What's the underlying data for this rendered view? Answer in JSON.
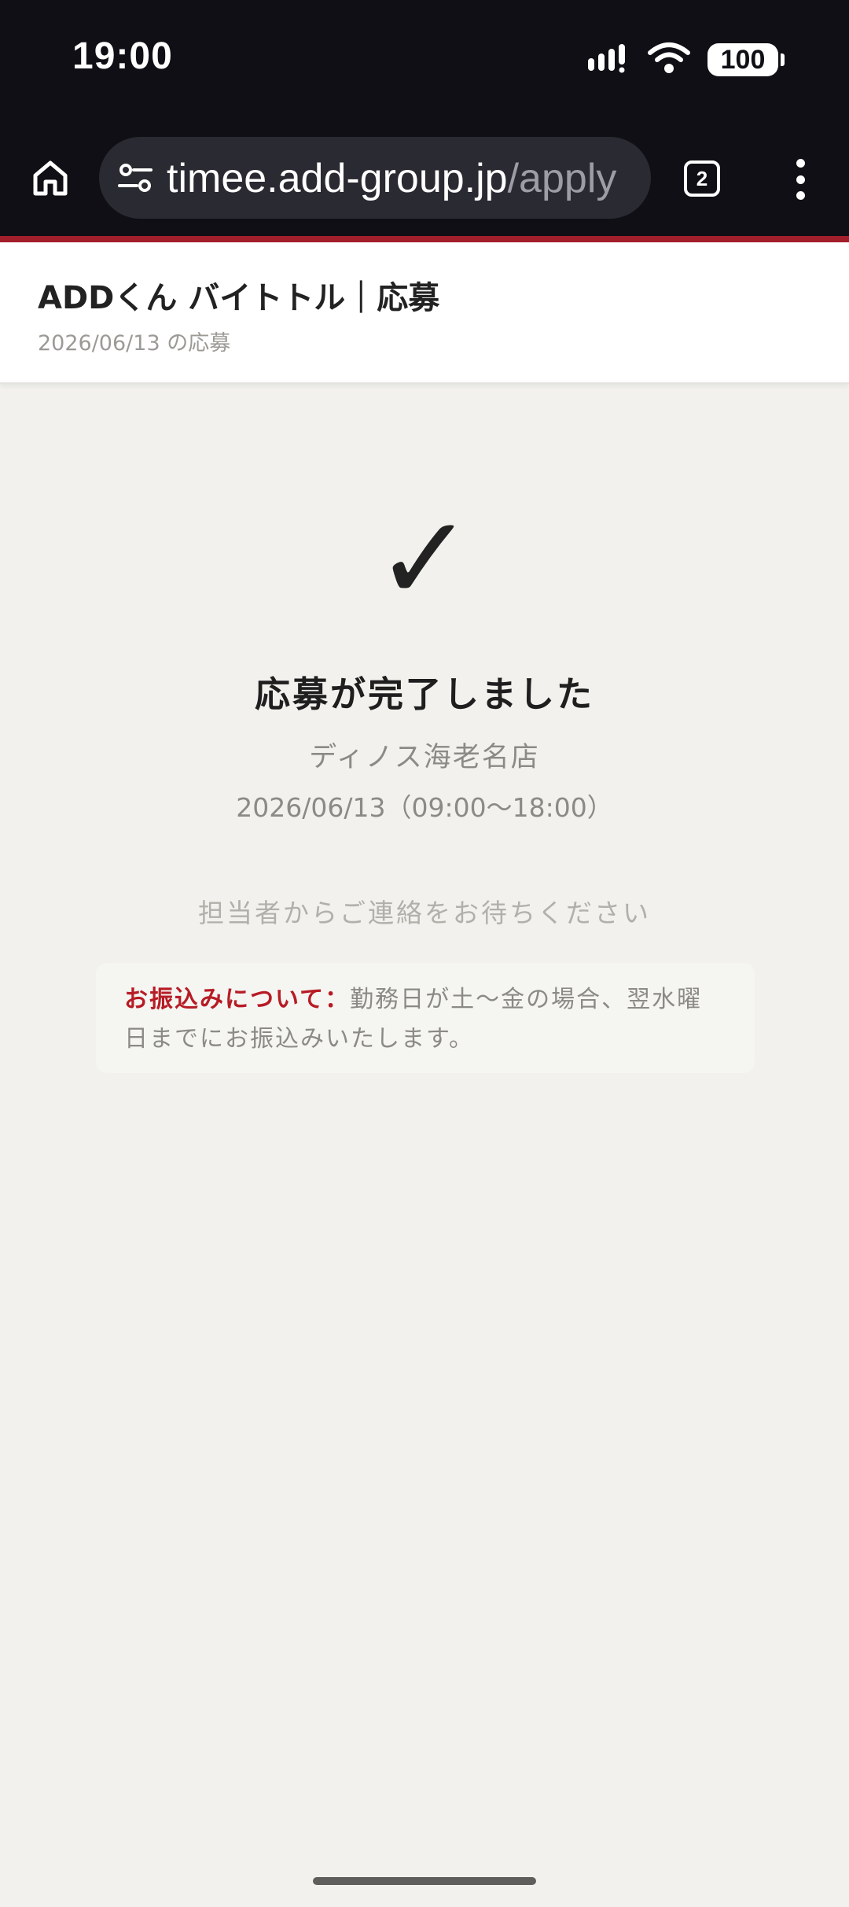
{
  "status_bar": {
    "time": "19:00",
    "battery": "100",
    "icons": [
      "signal-icon",
      "wifi-icon",
      "battery-icon"
    ]
  },
  "browser": {
    "url_host": "timee.add-group.jp",
    "url_path": "/apply",
    "tab_count": "2",
    "icons": [
      "home-icon",
      "tune-icon",
      "tabs-icon",
      "more-vert-icon"
    ]
  },
  "header": {
    "title": "ADDくん バイトトル｜応募",
    "subtitle": "2026/06/13 の応募"
  },
  "confirmation": {
    "check": "✓",
    "title": "応募が完了しました",
    "store": "ディノス海老名店",
    "shift": "2026/06/13（09:00〜18:00）",
    "wait_message": "担当者からご連絡をお待ちください",
    "notice_label": "お振込みについて：",
    "notice_text": "勤務日が土〜金の場合、翌水曜日までにお振込みいたします。"
  },
  "colors": {
    "accent": "#a31e2b",
    "notice_label": "#b71c25",
    "background": "#f2f1ed",
    "top_bar": "#0f0f15"
  }
}
